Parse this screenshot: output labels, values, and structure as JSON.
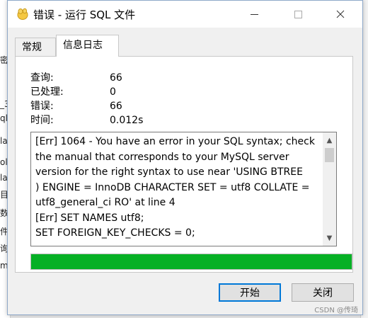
{
  "window": {
    "title": "错误 - 运行 SQL 文件",
    "minimize_label": "",
    "maximize_label": "",
    "close_label": "✕"
  },
  "tabs": [
    {
      "label": "常规",
      "active": false
    },
    {
      "label": "信息日志",
      "active": true
    }
  ],
  "stats": [
    {
      "label": "查询:",
      "value": "66"
    },
    {
      "label": "已处理:",
      "value": "0"
    },
    {
      "label": "错误:",
      "value": "66"
    },
    {
      "label": "时间:",
      "value": "0.012s"
    }
  ],
  "log": {
    "lines": [
      "[Err] 1064 - You have an error in your SQL syntax; check",
      "the manual that corresponds to your MySQL server",
      "version for the right syntax to use near 'USING BTREE",
      ") ENGINE = InnoDB CHARACTER SET = utf8 COLLATE =",
      "utf8_general_ci RO' at line 4",
      "[Err] SET NAMES utf8;",
      "SET FOREIGN_KEY_CHECKS = 0;"
    ]
  },
  "progress": {
    "fraction": 1.0,
    "color": "#06b025"
  },
  "buttons": {
    "start_label": "开始",
    "close_label": "关闭"
  },
  "background_fragments": [
    "密",
    "_3",
    "ql",
    "la",
    "ol",
    "la",
    "目",
    "数",
    "件",
    "询",
    "ma"
  ],
  "watermark": "CSDN @传琦"
}
